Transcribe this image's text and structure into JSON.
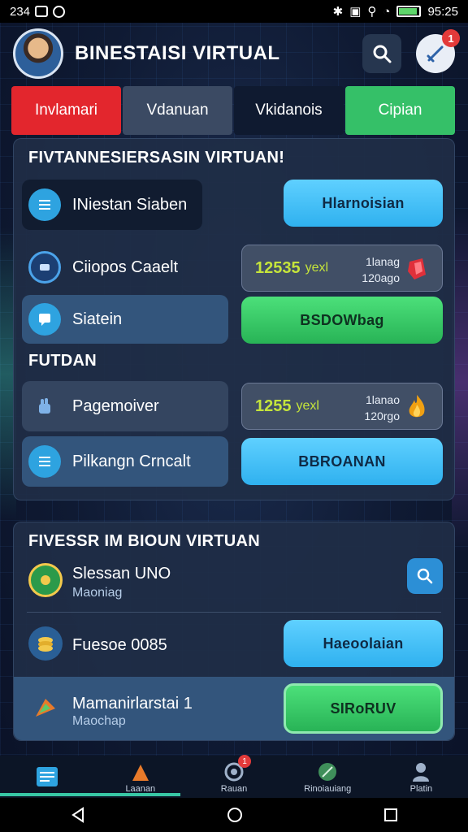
{
  "status_bar": {
    "time_left": "234",
    "time_right": "95:25"
  },
  "header": {
    "title": "BINESTAISI VIRTUAL",
    "notification_count": "1"
  },
  "tabs": [
    {
      "label": "Invlamari"
    },
    {
      "label": "Vdanuan"
    },
    {
      "label": "Vkidanois"
    },
    {
      "label": "Cipian"
    }
  ],
  "panel1": {
    "title": "FIVTANNESIERSASIN VIRTUAN!",
    "row1": {
      "label": "INiestan Siaben",
      "button": "Hlarnoisian"
    },
    "row2": {
      "label": "Ciiopos Caaelt",
      "amount": "12535",
      "unit": "yexl",
      "stack_top": "1lanag",
      "stack_bottom": "120ago"
    },
    "row3": {
      "label": "Siatein",
      "button": "BSDOWbag"
    },
    "section2_title": "FUTDAN",
    "row4": {
      "label": "Pagemoiver",
      "amount": "1255",
      "unit": "yexl",
      "stack_top": "1lanao",
      "stack_bottom": "120rgo"
    },
    "row5": {
      "label": "Pilkangn Crncalt",
      "button": "BBROANAN"
    }
  },
  "panel2": {
    "title": "FIVESSR IM BIOUN VIRTUAN",
    "row1": {
      "label": "Slessan UNO",
      "sub": "Maoniag"
    },
    "row2": {
      "label": "Fuesoe 0085",
      "button": "Haeoolaian"
    },
    "row3": {
      "label": "Mamanirlarstai 1",
      "sub": "Maochap",
      "button": "SIRoRUV"
    }
  },
  "bottom_nav": [
    {
      "label": ""
    },
    {
      "label": "Laanan"
    },
    {
      "label": "Rauan",
      "badge": "1"
    },
    {
      "label": "Rinoiauiang"
    },
    {
      "label": "Platin"
    }
  ],
  "colors": {
    "tab_red": "#e3262d",
    "tab_green": "#35c068",
    "button_cyan": "#2fb1ef",
    "button_green": "#28b356",
    "amount_yellow": "#c5e43b"
  },
  "icons": {
    "search": "search-icon",
    "notification": "sword-icon",
    "list": "list-icon",
    "coins": "coins-icon",
    "chat": "chat-icon",
    "fist": "power-icon",
    "medal": "medal-icon",
    "rocket": "rocket-icon"
  }
}
